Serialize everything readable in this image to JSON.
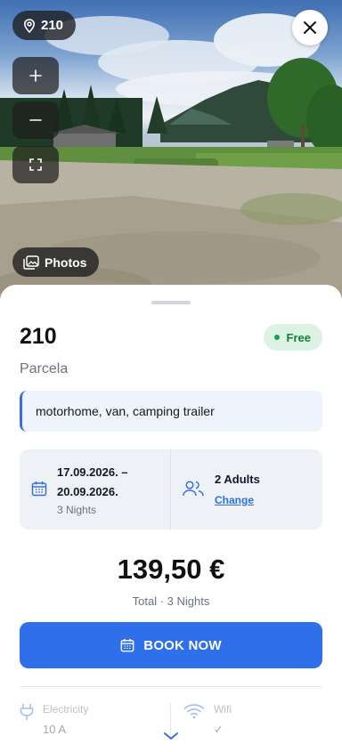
{
  "photo": {
    "spot_badge": {
      "icon": "map-pin-icon",
      "text": "210"
    },
    "photos_button": {
      "icon": "images-icon",
      "label": "Photos"
    },
    "controls": {
      "zoom_in_icon": "plus-icon",
      "zoom_out_icon": "minus-icon",
      "fullscreen_icon": "fullscreen-icon",
      "close_icon": "close-icon"
    }
  },
  "spot": {
    "number": "210",
    "type": "Parcela",
    "status": "Free",
    "vehicles": "motorhome, van, camping trailer"
  },
  "booking": {
    "dates_range": "17.09.2026. – 20.09.2026.",
    "nights": "3 Nights",
    "guests": "2 Adults",
    "change_label": "Change",
    "price": "139,50 €",
    "price_note": "Total · 3 Nights",
    "book_button": "BOOK NOW"
  },
  "amenities": [
    {
      "icon": "plug-icon",
      "label": "Electricity",
      "value": "10 A"
    },
    {
      "icon": "wifi-icon",
      "label": "Wifi",
      "value": "✓"
    }
  ],
  "colors": {
    "accent": "#2f6fe9",
    "status_bg": "#dcf3e3",
    "status_text": "#15803d",
    "info_border": "#3b6fd8"
  }
}
